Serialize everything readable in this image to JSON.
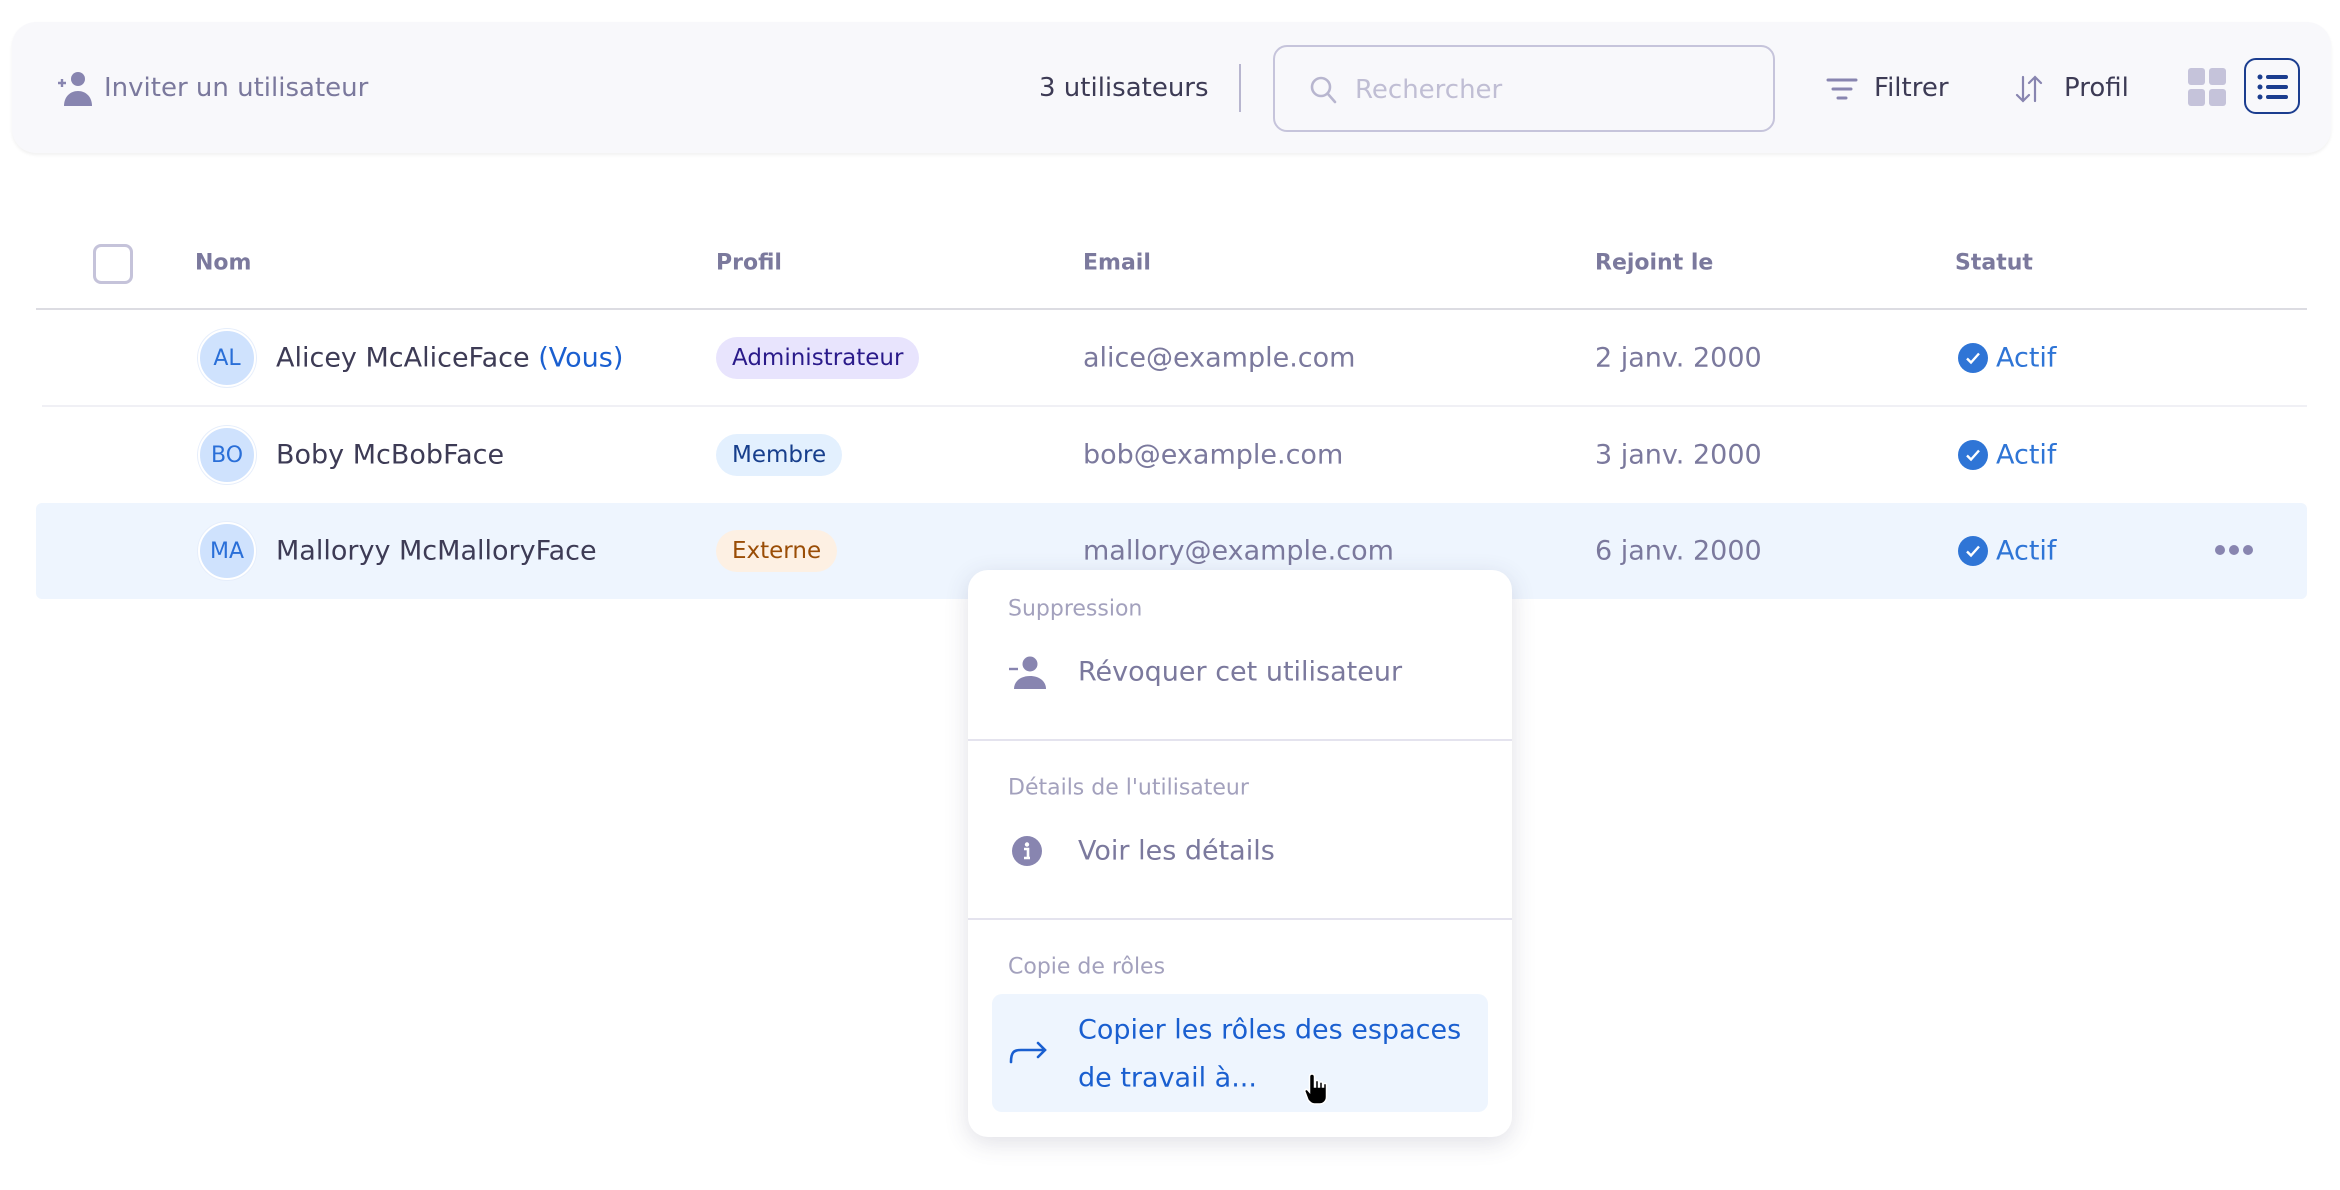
{
  "toolbar": {
    "invite_label": "Inviter un utilisateur",
    "user_count": "3 utilisateurs",
    "search_placeholder": "Rechercher",
    "search_value": "",
    "filter_label": "Filtrer",
    "sort_label": "Profil",
    "view_modes": [
      "grid-icon",
      "list-icon"
    ],
    "active_view": "list"
  },
  "table": {
    "columns": [
      "Nom",
      "Profil",
      "Email",
      "Rejoint le",
      "Statut"
    ],
    "rows": [
      {
        "initials": "AL",
        "name": "Alicey McAliceFace",
        "you": "(Vous)",
        "profile": "Administrateur",
        "email": "alice@example.com",
        "joined": "2 janv. 2000",
        "status": "Actif"
      },
      {
        "initials": "BO",
        "name": "Boby McBobFace",
        "you": "",
        "profile": "Membre",
        "email": "bob@example.com",
        "joined": "3 janv. 2000",
        "status": "Actif"
      },
      {
        "initials": "MA",
        "name": "Malloryy McMalloryFace",
        "you": "",
        "profile": "Externe",
        "email": "mallory@example.com",
        "joined": "6 janv. 2000",
        "status": "Actif"
      }
    ]
  },
  "context_menu": {
    "sections": [
      {
        "label": "Suppression",
        "item": "Révoquer cet utilisateur",
        "icon": "user-minus-icon"
      },
      {
        "label": "Détails de l'utilisateur",
        "item": "Voir les détails",
        "icon": "info-icon"
      },
      {
        "label": "Copie de rôles",
        "item_line1": "Copier les rôles des espaces",
        "item_line2": "de travail à...",
        "icon": "arrow-right-icon"
      }
    ]
  },
  "colors": {
    "accent": "#1a5fd0",
    "status_active": "#2f75d6",
    "selected_row": "#eef5fe",
    "badge_admin_bg": "#e8e4fd",
    "badge_member_bg": "#e3f0fe",
    "badge_external_bg": "#fdf0e3"
  }
}
